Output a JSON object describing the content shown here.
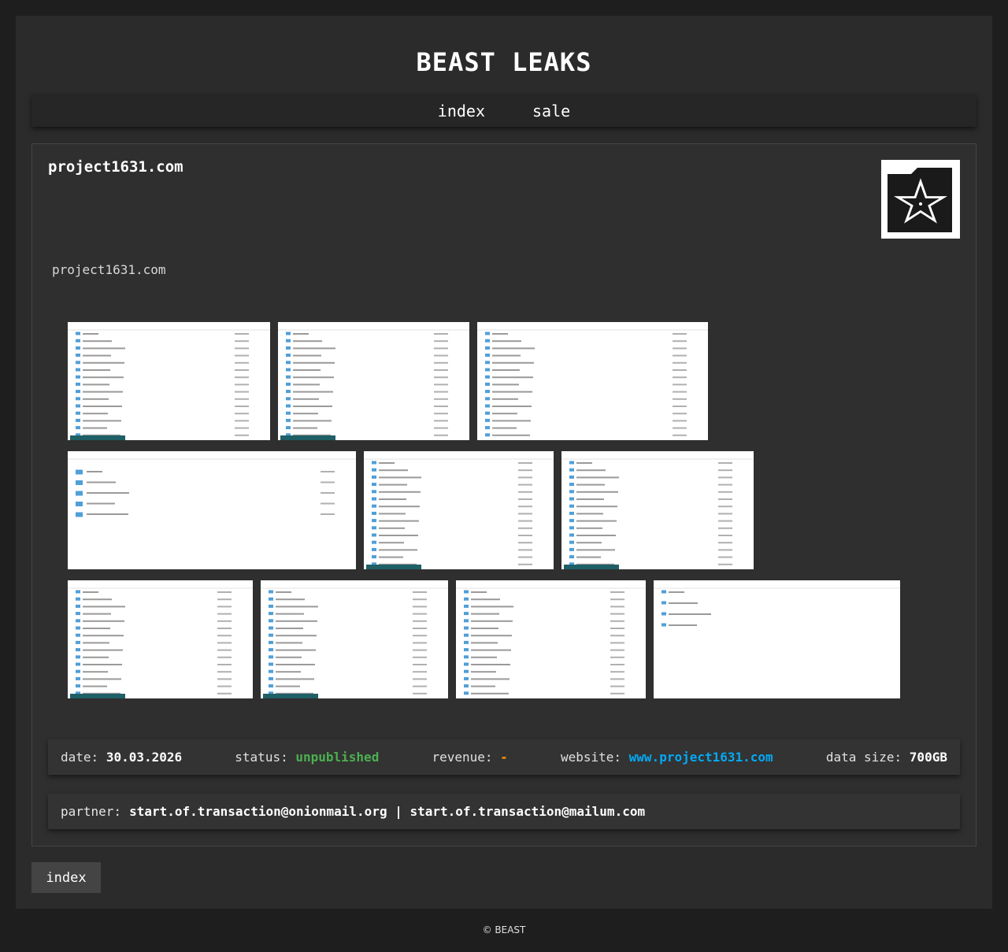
{
  "site": {
    "title": "BEAST LEAKS",
    "nav": [
      {
        "label": "index"
      },
      {
        "label": "sale"
      }
    ]
  },
  "post": {
    "title": "project1631.com",
    "description": "project1631.com",
    "logo_icon": "folder-pentagram-icon",
    "screenshots_count": 10,
    "info": {
      "date_label": "date:",
      "date_value": "30.03.2026",
      "status_label": "status:",
      "status_value": "unpublished",
      "status_color": "#4caf50",
      "revenue_label": "revenue:",
      "revenue_value": "-",
      "revenue_color": "#ff9800",
      "website_label": "website:",
      "website_value": "www.project1631.com",
      "website_color": "#03a9f4",
      "size_label": "data size:",
      "size_value": "700GB"
    },
    "partner": {
      "label": "partner:",
      "value": "start.of.transaction@onionmail.org | start.of.transaction@mailum.com"
    }
  },
  "back_button": {
    "label": "index"
  },
  "footer": {
    "text": "© BEAST"
  }
}
